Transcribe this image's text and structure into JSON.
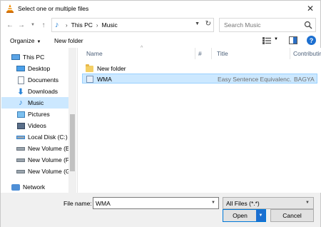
{
  "window": {
    "title": "Select one or multiple files",
    "close_glyph": "✕"
  },
  "address": {
    "crumbs": [
      "This PC",
      "Music"
    ],
    "search_placeholder": "Search Music"
  },
  "toolbar": {
    "organize_label": "Organize",
    "new_folder_label": "New folder"
  },
  "sidebar": {
    "items": [
      {
        "label": "This PC",
        "icon": "computer-icon",
        "selected": false
      },
      {
        "label": "Desktop",
        "icon": "desktop-folder-icon",
        "selected": false
      },
      {
        "label": "Documents",
        "icon": "documents-folder-icon",
        "selected": false
      },
      {
        "label": "Downloads",
        "icon": "downloads-folder-icon",
        "selected": false
      },
      {
        "label": "Music",
        "icon": "music-icon",
        "selected": true
      },
      {
        "label": "Pictures",
        "icon": "pictures-folder-icon",
        "selected": false
      },
      {
        "label": "Videos",
        "icon": "videos-folder-icon",
        "selected": false
      },
      {
        "label": "Local Disk (C:)",
        "icon": "drive-icon",
        "selected": false
      },
      {
        "label": "New Volume (E:)",
        "icon": "drive-icon",
        "selected": false
      },
      {
        "label": "New Volume (F:)",
        "icon": "drive-icon",
        "selected": false
      },
      {
        "label": "New Volume (G:)",
        "icon": "drive-icon",
        "selected": false
      },
      {
        "label": "Network",
        "icon": "network-icon",
        "selected": false
      }
    ]
  },
  "filelist": {
    "columns": [
      "Name",
      "#",
      "Title",
      "Contributing artists"
    ],
    "rows": [
      {
        "name": "New folder",
        "number": "",
        "title": "",
        "artists": "",
        "icon": "folder-icon",
        "selected": false
      },
      {
        "name": "WMA",
        "number": "",
        "title": "Easy Sentence Equivalenc...",
        "artists": "BAGYA",
        "icon": "audio-file-icon",
        "selected": true
      }
    ]
  },
  "footer": {
    "file_name_label": "File name:",
    "file_name_value": "WMA",
    "filter_value": "All Files (*.*)",
    "open_label": "Open",
    "cancel_label": "Cancel"
  },
  "colors": {
    "accent": "#0078d7",
    "selection": "#cce8ff"
  }
}
